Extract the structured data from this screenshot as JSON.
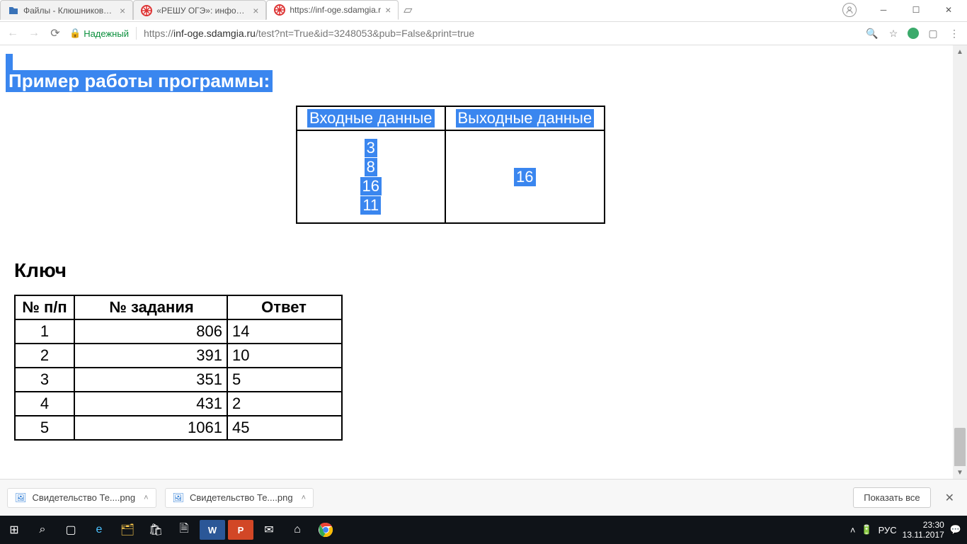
{
  "tabs": [
    {
      "title": "Файлы - Клюшникова К",
      "active": false
    },
    {
      "title": "«РЕШУ ОГЭ»: информат",
      "active": false
    },
    {
      "title": "https://inf-oge.sdamgia.r",
      "active": true
    }
  ],
  "secure_label": "Надежный",
  "url_plain": "https://",
  "url_domain": "inf-oge.sdamgia.ru",
  "url_path": "/test?nt=True&id=3248053&pub=False&print=true",
  "selected_title": "Пример работы программы:",
  "io_table": {
    "head_in": "Входные данные",
    "head_out": "Выходные данные",
    "in_lines": [
      "3",
      "8",
      "16",
      "11"
    ],
    "out_lines": [
      "16"
    ]
  },
  "key_title": "Ключ",
  "answer_table": {
    "headers": [
      "№ п/п",
      "№ задания",
      "Ответ"
    ],
    "rows": [
      [
        "1",
        "806",
        "14"
      ],
      [
        "2",
        "391",
        "10"
      ],
      [
        "3",
        "351",
        "5"
      ],
      [
        "4",
        "431",
        "2"
      ],
      [
        "5",
        "1061",
        "45"
      ]
    ]
  },
  "downloads": [
    {
      "name": "Свидетельство Те....png"
    },
    {
      "name": "Свидетельство Те....png"
    }
  ],
  "show_all": "Показать все",
  "tray": {
    "lang": "РУС",
    "time": "23:30",
    "date": "13.11.2017"
  }
}
